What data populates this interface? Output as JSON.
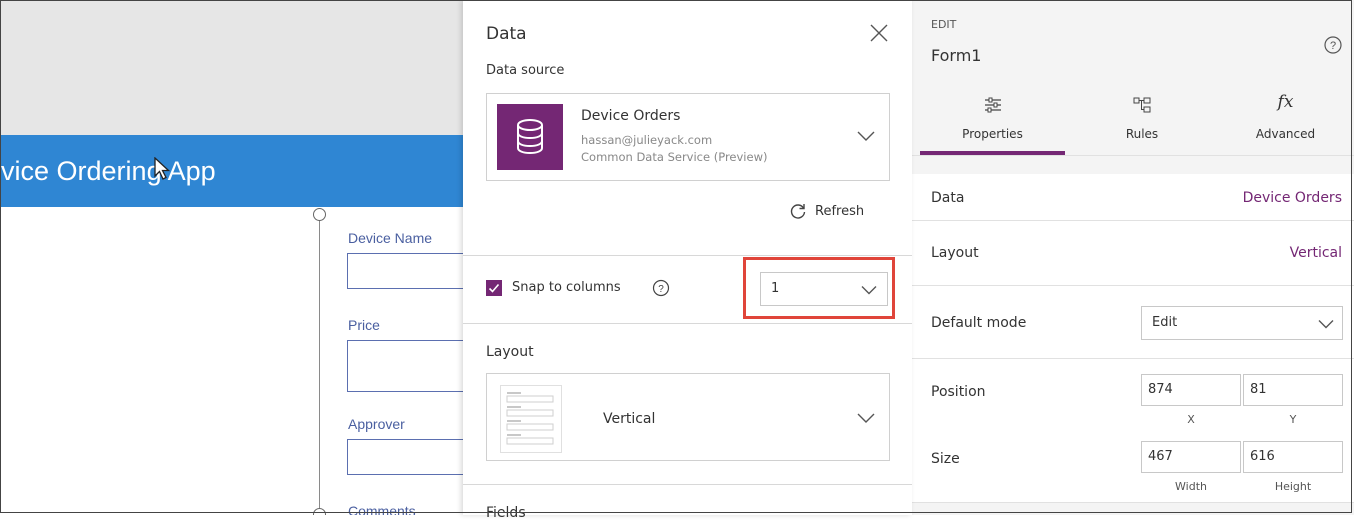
{
  "canvas": {
    "app_title": "evice Ordering App",
    "fields": [
      {
        "label": "Device Name"
      },
      {
        "label": "Price"
      },
      {
        "label": "Approver"
      },
      {
        "label": "Comments"
      }
    ]
  },
  "data_panel": {
    "title": "Data",
    "data_source_label": "Data source",
    "data_source": {
      "name": "Device Orders",
      "email": "hassan@julieyack.com",
      "service": "Common Data Service (Preview)"
    },
    "refresh_label": "Refresh",
    "snap_label": "Snap to columns",
    "snap_checked": true,
    "columns_value": "1",
    "layout_label": "Layout",
    "layout_value": "Vertical",
    "fields_label": "Fields"
  },
  "properties_panel": {
    "section": "EDIT",
    "control_name": "Form1",
    "tabs": [
      {
        "label": "Properties",
        "icon": "sliders-icon",
        "active": true
      },
      {
        "label": "Rules",
        "icon": "rules-icon",
        "active": false
      },
      {
        "label": "Advanced",
        "icon": "fx-icon",
        "active": false
      }
    ],
    "data_label": "Data",
    "data_value": "Device Orders",
    "layout_label": "Layout",
    "layout_value": "Vertical",
    "default_mode_label": "Default mode",
    "default_mode_value": "Edit",
    "position_label": "Position",
    "position": {
      "x": "874",
      "y": "81",
      "x_caption": "X",
      "y_caption": "Y"
    },
    "size_label": "Size",
    "size": {
      "width": "467",
      "height": "616",
      "width_caption": "Width",
      "height_caption": "Height"
    }
  },
  "colors": {
    "accent": "#742774",
    "app_header": "#2f86d3",
    "highlight": "#e0453a"
  }
}
